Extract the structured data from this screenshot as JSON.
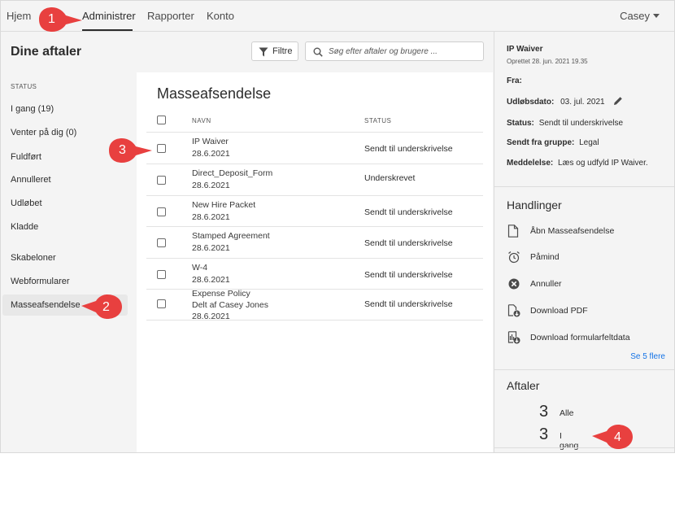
{
  "nav": {
    "items": [
      "Hjem",
      "Administrer",
      "Rapporter",
      "Konto"
    ],
    "user": "Casey"
  },
  "header": {
    "title": "Dine aftaler",
    "filter_label": "Filtre",
    "search_placeholder": "Søg efter aftaler og brugere ..."
  },
  "sidebar": {
    "heading": "STATUS",
    "items": [
      "I gang (19)",
      "Venter på dig (0)",
      "Fuldført",
      "Annulleret",
      "Udløbet",
      "Kladde",
      "Skabeloner",
      "Webformularer",
      "Masseafsendelse"
    ]
  },
  "list": {
    "title": "Masseafsendelse",
    "col_name": "NAVN",
    "col_status": "STATUS",
    "rows": [
      {
        "name": "IP Waiver",
        "extra": "",
        "date": "28.6.2021",
        "status": "Sendt til underskrivelse"
      },
      {
        "name": "Direct_Deposit_Form",
        "extra": "",
        "date": "28.6.2021",
        "status": "Underskrevet"
      },
      {
        "name": "New Hire Packet",
        "extra": "",
        "date": "28.6.2021",
        "status": "Sendt til underskrivelse"
      },
      {
        "name": "Stamped Agreement",
        "extra": "",
        "date": "28.6.2021",
        "status": "Sendt til underskrivelse"
      },
      {
        "name": "W-4",
        "extra": "",
        "date": "28.6.2021",
        "status": "Sendt til underskrivelse"
      },
      {
        "name": "Expense Policy",
        "extra": "Delt af Casey Jones",
        "date": "28.6.2021",
        "status": "Sendt til underskrivelse"
      }
    ]
  },
  "details": {
    "title": "IP Waiver",
    "created": "Oprettet 28. jun. 2021 19.35",
    "from_label": "Fra:",
    "expiry_label": "Udløbsdato:",
    "expiry_value": "03. jul. 2021",
    "status_label": "Status:",
    "status_value": "Sendt til underskrivelse",
    "group_label": "Sendt fra gruppe:",
    "group_value": "Legal",
    "message_label": "Meddelelse:",
    "message_value": "Læs og udfyld IP Waiver."
  },
  "actions": {
    "heading": "Handlinger",
    "items": [
      "Åbn Masseafsendelse",
      "Påmind",
      "Annuller",
      "Download PDF",
      "Download formularfeltdata"
    ],
    "see_more": "Se 5 flere"
  },
  "agreements": {
    "heading": "Aftaler",
    "items": [
      {
        "count": "3",
        "label": "Alle"
      },
      {
        "count": "3",
        "label": "I gang"
      }
    ]
  },
  "callouts": [
    "1",
    "2",
    "3",
    "4"
  ],
  "colors": {
    "accent": "#1473e6",
    "callout": "#e8403f"
  }
}
